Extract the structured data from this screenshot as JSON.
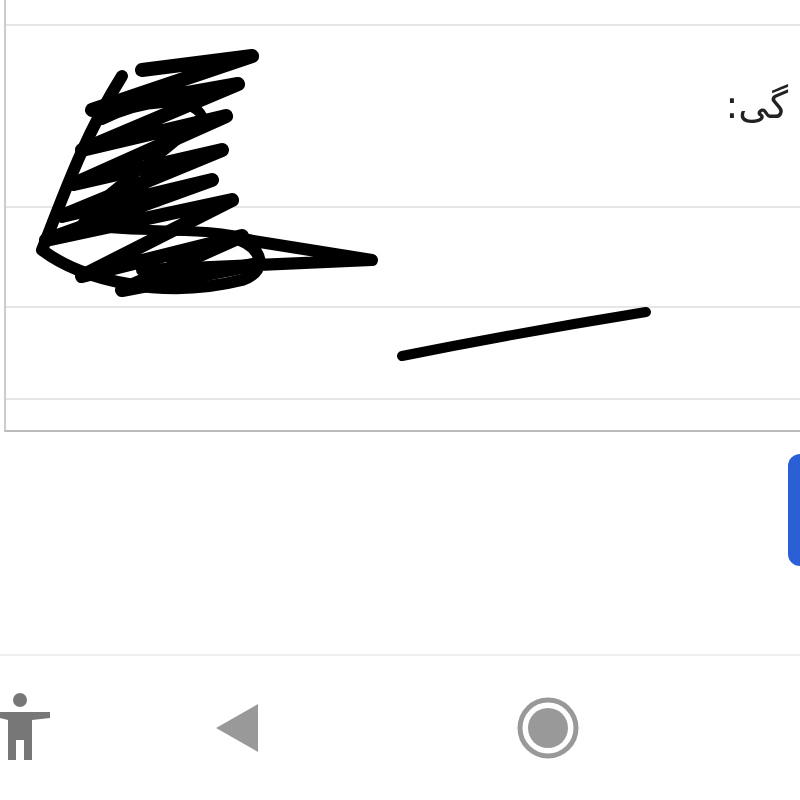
{
  "signature_field": {
    "label": "گی:"
  }
}
